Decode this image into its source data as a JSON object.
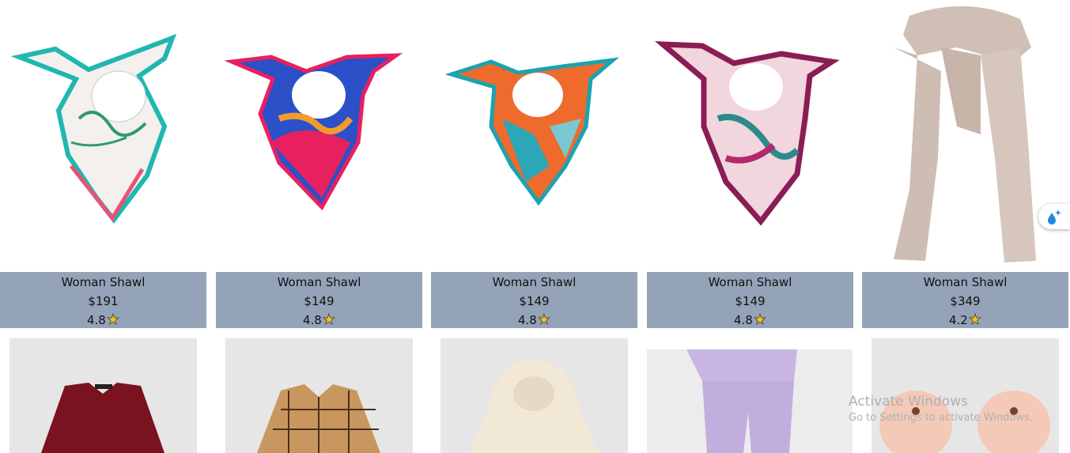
{
  "products": [
    {
      "title": "Woman Shawl",
      "price": "$191",
      "rating": "4.8"
    },
    {
      "title": "Woman Shawl",
      "price": "$149",
      "rating": "4.8"
    },
    {
      "title": "Woman Shawl",
      "price": "$149",
      "rating": "4.8"
    },
    {
      "title": "Woman Shawl",
      "price": "$149",
      "rating": "4.8"
    },
    {
      "title": "Woman Shawl",
      "price": "$349",
      "rating": "4.2"
    }
  ],
  "star_icon": "star-icon",
  "float_button": {
    "icon": "water-drop-sparkle-icon",
    "color": "#1e88e5"
  },
  "watermark": {
    "line1": "Activate Windows",
    "line2": "Go to Settings to activate Windows."
  },
  "colors": {
    "info_bg": "#94a3b8",
    "star": "#f5c518"
  }
}
